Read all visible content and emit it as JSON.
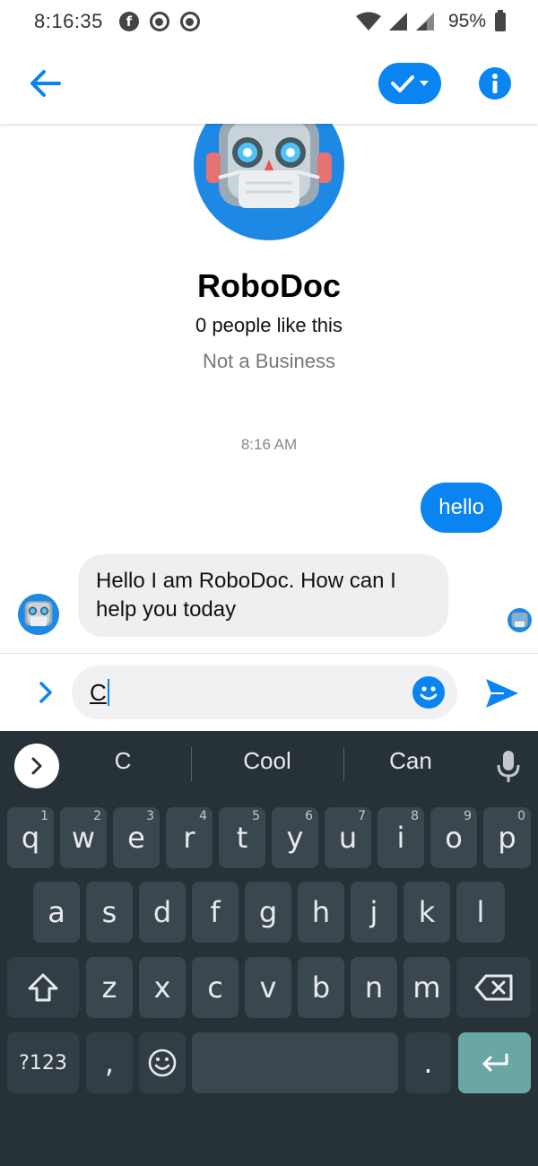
{
  "status_bar": {
    "time": "8:16:35",
    "battery": "95%",
    "notification_icons": [
      "facebook-icon",
      "record-icon",
      "record-icon"
    ],
    "right_icons": [
      "wifi-icon",
      "signal-icon",
      "signal-roaming-icon",
      "battery-icon"
    ]
  },
  "app_bar": {
    "back_icon": "arrow-left-icon",
    "check_icon": "checkmark-dropdown-icon",
    "info_icon": "info-icon",
    "accent_color": "#0a84f0"
  },
  "profile": {
    "name": "RoboDoc",
    "likes": "0 people like this",
    "category": "Not a Business"
  },
  "conversation": {
    "timestamp": "8:16 AM",
    "messages": [
      {
        "from": "user",
        "text": "hello"
      },
      {
        "from": "bot",
        "text": "Hello I am RoboDoc. How can I help you today"
      }
    ]
  },
  "composer": {
    "value": "C",
    "expand_icon": "chevron-right-icon",
    "emoji_icon": "smiley-icon",
    "send_icon": "send-icon"
  },
  "keyboard": {
    "suggestions": [
      "C",
      "Cool",
      "Can"
    ],
    "row1": [
      {
        "k": "q",
        "h": "1"
      },
      {
        "k": "w",
        "h": "2"
      },
      {
        "k": "e",
        "h": "3"
      },
      {
        "k": "r",
        "h": "4"
      },
      {
        "k": "t",
        "h": "5"
      },
      {
        "k": "y",
        "h": "6"
      },
      {
        "k": "u",
        "h": "7"
      },
      {
        "k": "i",
        "h": "8"
      },
      {
        "k": "o",
        "h": "9"
      },
      {
        "k": "p",
        "h": "0"
      }
    ],
    "row2": [
      "a",
      "s",
      "d",
      "f",
      "g",
      "h",
      "j",
      "k",
      "l"
    ],
    "row3": [
      "z",
      "x",
      "c",
      "v",
      "b",
      "n",
      "m"
    ],
    "symbols_key": "?123",
    "comma_key": ",",
    "period_key": ".",
    "theme_color": "#263238",
    "enter_color": "#6aa7a4"
  }
}
